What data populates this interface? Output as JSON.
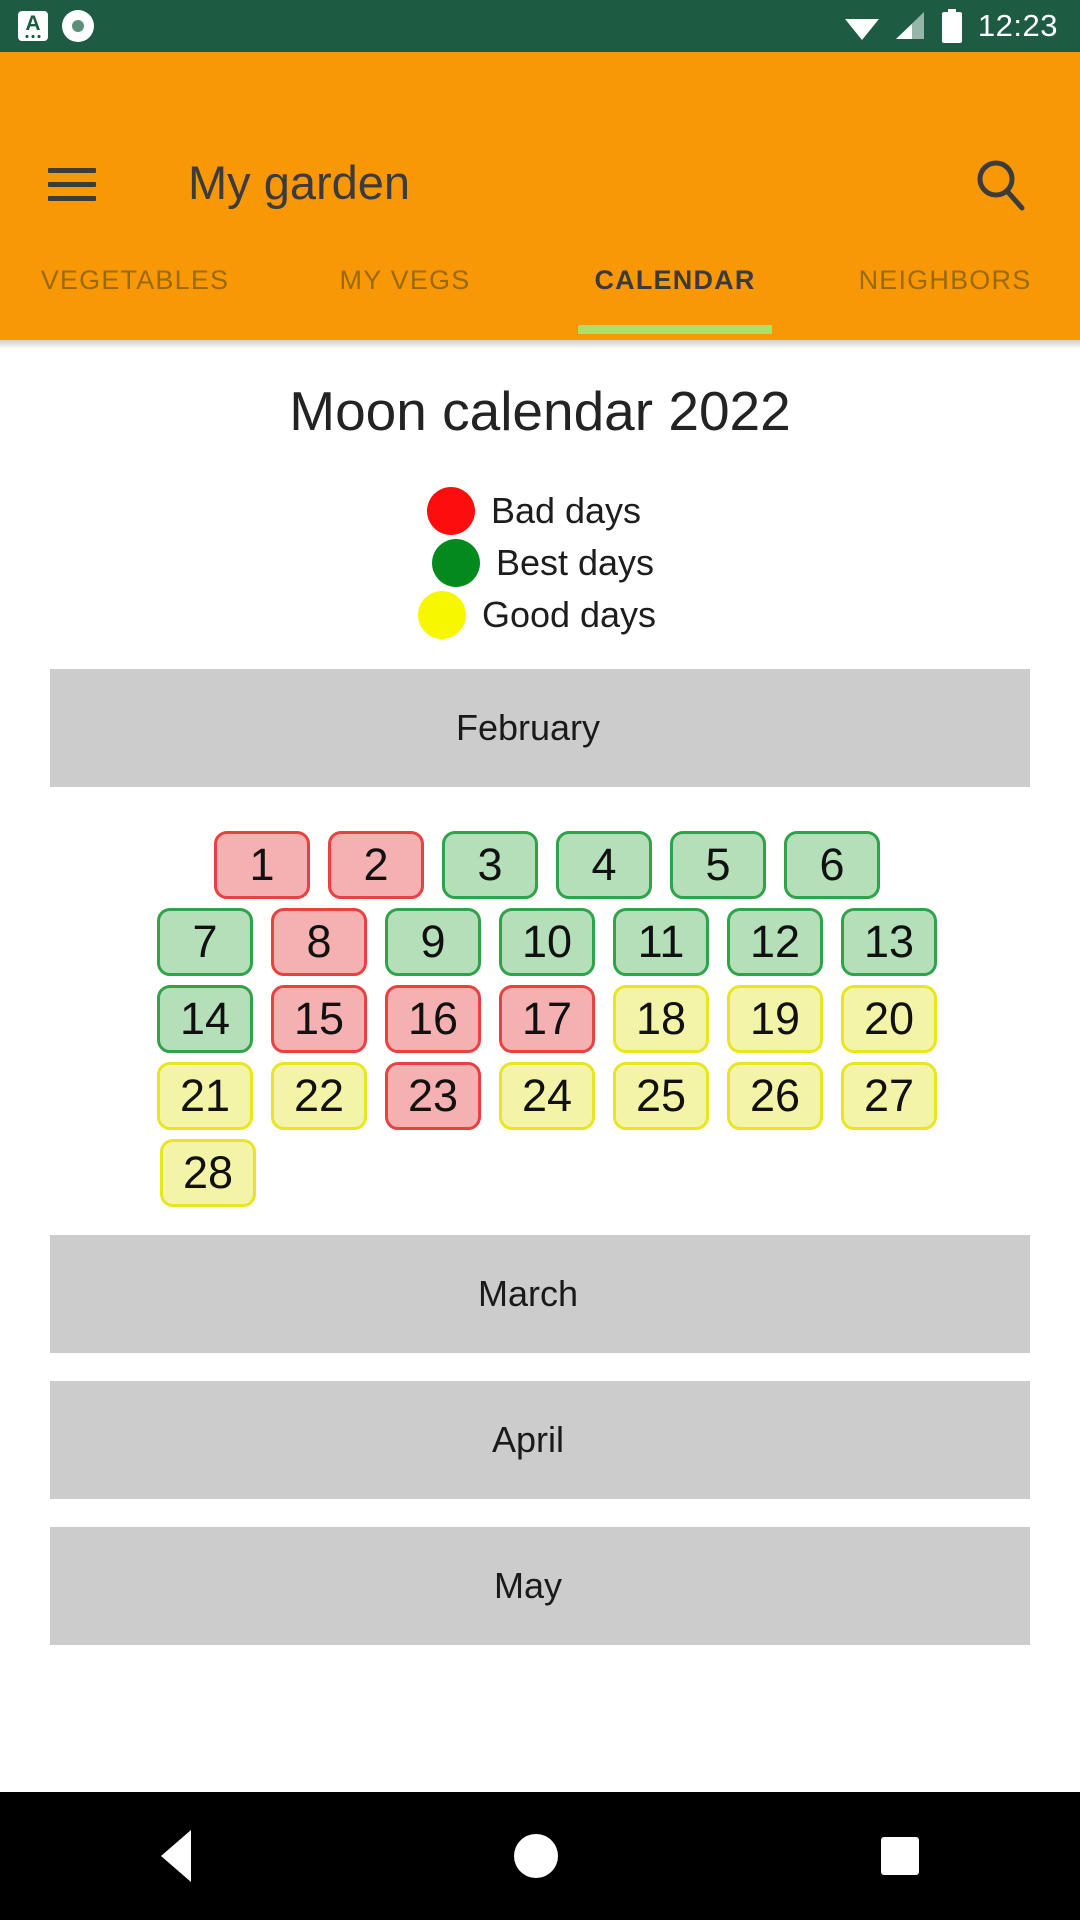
{
  "statusbar": {
    "time": "12:23",
    "left_icons": [
      "keyboard-language-icon",
      "record-circle-icon"
    ],
    "right_icons": [
      "wifi-icon",
      "cellular-signal-icon",
      "battery-icon"
    ],
    "background_color": "#1d5c43"
  },
  "appbar": {
    "title": "My garden",
    "menu_icon": "hamburger-menu-icon",
    "search_icon": "search-icon",
    "background_color": "#f99806"
  },
  "tabs": {
    "items": [
      {
        "label": "VEGETABLES",
        "active": false
      },
      {
        "label": "MY VEGS",
        "active": false
      },
      {
        "label": "CALENDAR",
        "active": true
      },
      {
        "label": "NEIGHBORS",
        "active": false
      }
    ],
    "indicator_color": "#aae162",
    "active_index": 2
  },
  "main": {
    "page_title": "Moon calendar 2022",
    "legend": [
      {
        "label": "Bad days",
        "color": "#fd0d0d"
      },
      {
        "label": "Best days",
        "color": "#028a1c"
      },
      {
        "label": "Good days",
        "color": "#f7f700"
      }
    ],
    "months": [
      {
        "name": "February",
        "expanded": true,
        "rows": [
          [
            {
              "day": "1",
              "type": "bad"
            },
            {
              "day": "2",
              "type": "bad"
            },
            {
              "day": "3",
              "type": "best"
            },
            {
              "day": "4",
              "type": "best"
            },
            {
              "day": "5",
              "type": "best"
            },
            {
              "day": "6",
              "type": "best"
            }
          ],
          [
            {
              "day": "7",
              "type": "best"
            },
            {
              "day": "8",
              "type": "bad"
            },
            {
              "day": "9",
              "type": "best"
            },
            {
              "day": "10",
              "type": "best"
            },
            {
              "day": "11",
              "type": "best"
            },
            {
              "day": "12",
              "type": "best"
            },
            {
              "day": "13",
              "type": "best"
            }
          ],
          [
            {
              "day": "14",
              "type": "best"
            },
            {
              "day": "15",
              "type": "bad"
            },
            {
              "day": "16",
              "type": "bad"
            },
            {
              "day": "17",
              "type": "bad"
            },
            {
              "day": "18",
              "type": "good"
            },
            {
              "day": "19",
              "type": "good"
            },
            {
              "day": "20",
              "type": "good"
            }
          ],
          [
            {
              "day": "21",
              "type": "good"
            },
            {
              "day": "22",
              "type": "good"
            },
            {
              "day": "23",
              "type": "bad"
            },
            {
              "day": "24",
              "type": "good"
            },
            {
              "day": "25",
              "type": "good"
            },
            {
              "day": "26",
              "type": "good"
            },
            {
              "day": "27",
              "type": "good"
            }
          ],
          [
            {
              "day": "28",
              "type": "good"
            }
          ]
        ]
      },
      {
        "name": "March",
        "expanded": false,
        "rows": []
      },
      {
        "name": "April",
        "expanded": false,
        "rows": []
      },
      {
        "name": "May",
        "expanded": false,
        "rows": []
      }
    ],
    "month_bar_color": "#cccccc",
    "day_colors": {
      "bad_fill": "#f5b1b1",
      "bad_border": "#e8413f",
      "best_fill": "#b4dfb8",
      "best_border": "#2fa24a",
      "good_fill": "#f4f4a8",
      "good_border": "#e8e622"
    }
  },
  "navbar": {
    "back_icon": "back-triangle-icon",
    "home_icon": "home-circle-icon",
    "recents_icon": "recents-square-icon"
  }
}
